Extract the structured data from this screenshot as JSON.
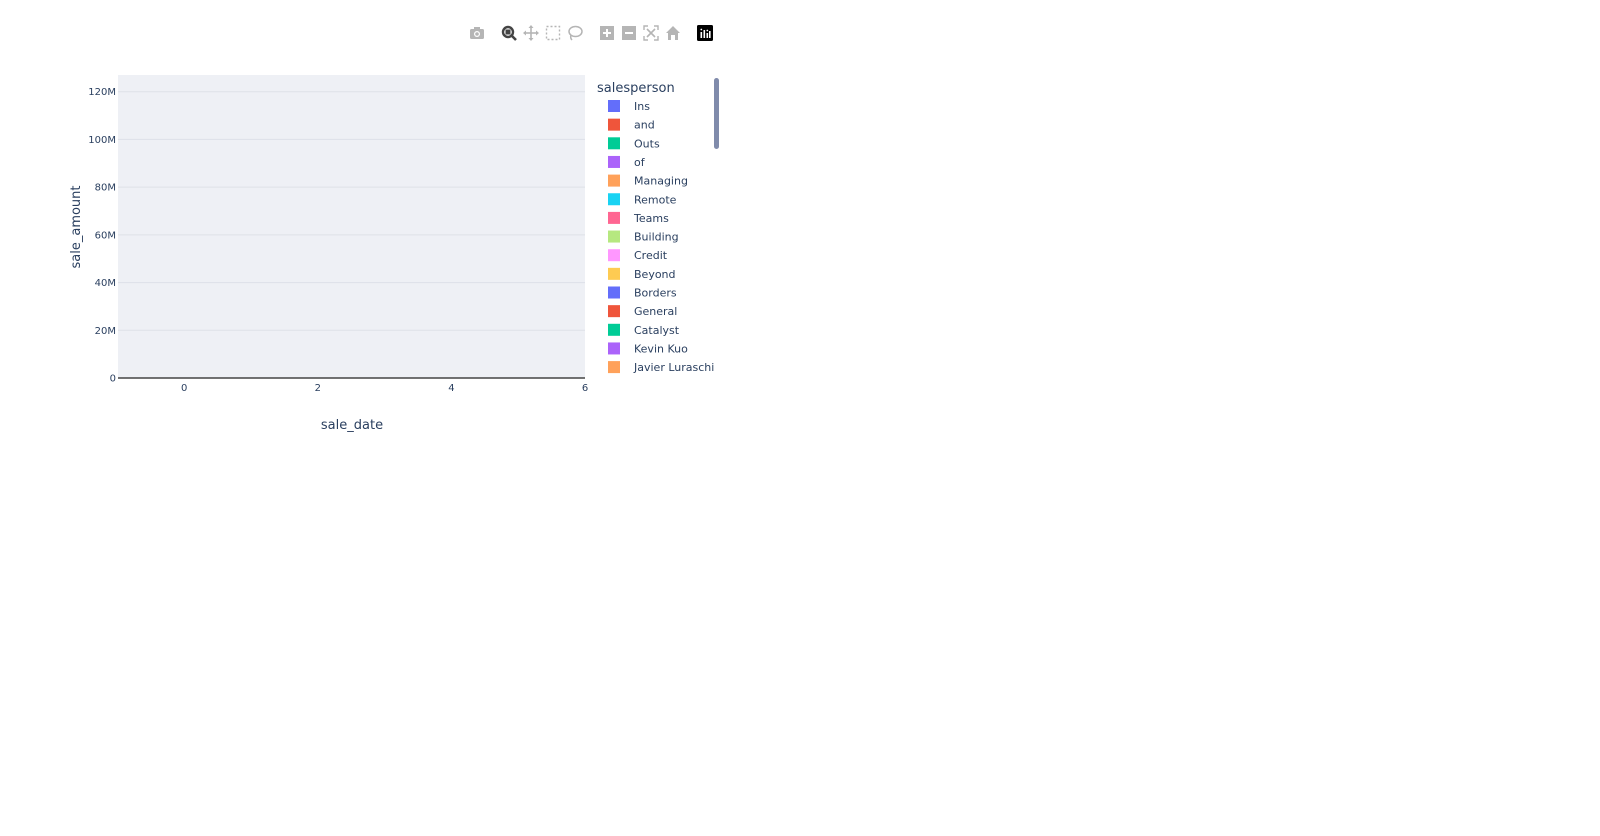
{
  "chart_data": {
    "type": "bar",
    "title": "",
    "xlabel": "sale_date",
    "ylabel": "sale_amount",
    "xlim": [
      -0.99,
      6
    ],
    "ylim": [
      0,
      127
    ],
    "y_unit": "M",
    "x_ticks": [
      0,
      2,
      4,
      6
    ],
    "x_tick_labels": [
      "0",
      "2",
      "4",
      "6"
    ],
    "y_ticks": [
      0,
      20,
      40,
      60,
      80,
      100,
      120
    ],
    "y_tick_labels": [
      "0",
      "20M",
      "40M",
      "60M",
      "80M",
      "100M",
      "120M"
    ],
    "grid": true,
    "legend_position": "right",
    "series": [],
    "legend": {
      "title": "salesperson",
      "items": [
        {
          "name": "Ins",
          "color": "#636efa"
        },
        {
          "name": "and",
          "color": "#ef553b"
        },
        {
          "name": "Outs",
          "color": "#00cc96"
        },
        {
          "name": "of",
          "color": "#ab63fa"
        },
        {
          "name": "Managing",
          "color": "#ffa15a"
        },
        {
          "name": "Remote",
          "color": "#19d3f3"
        },
        {
          "name": "Teams",
          "color": "#ff6692"
        },
        {
          "name": "Building",
          "color": "#b6e880"
        },
        {
          "name": "Credit",
          "color": "#ff97ff"
        },
        {
          "name": "Beyond",
          "color": "#fecb52"
        },
        {
          "name": "Borders",
          "color": "#636efa"
        },
        {
          "name": "General",
          "color": "#ef553b"
        },
        {
          "name": "Catalyst",
          "color": "#00cc96"
        },
        {
          "name": "Kevin Kuo",
          "color": "#ab63fa"
        },
        {
          "name": "Javier Luraschi",
          "color": "#ffa15a"
        }
      ]
    }
  },
  "colors": {
    "plot_bg": "#e5ecf6",
    "grid": "#ffffff",
    "text": "#2a3f5f"
  },
  "modebar": {
    "buttons": [
      {
        "name": "camera-icon",
        "label": "Download plot as a png",
        "active": false
      },
      {
        "name": "zoom-icon",
        "label": "Zoom",
        "active": true
      },
      {
        "name": "pan-icon",
        "label": "Pan",
        "active": false
      },
      {
        "name": "box-select-icon",
        "label": "Box Select",
        "active": false
      },
      {
        "name": "lasso-select-icon",
        "label": "Lasso Select",
        "active": false
      },
      {
        "name": "zoom-in-icon",
        "label": "Zoom in",
        "active": false
      },
      {
        "name": "zoom-out-icon",
        "label": "Zoom out",
        "active": false
      },
      {
        "name": "autoscale-icon",
        "label": "Autoscale",
        "active": false
      },
      {
        "name": "reset-axes-icon",
        "label": "Reset axes",
        "active": false
      },
      {
        "name": "plotly-logo-icon",
        "label": "Produced with Plotly",
        "active": false
      }
    ]
  }
}
